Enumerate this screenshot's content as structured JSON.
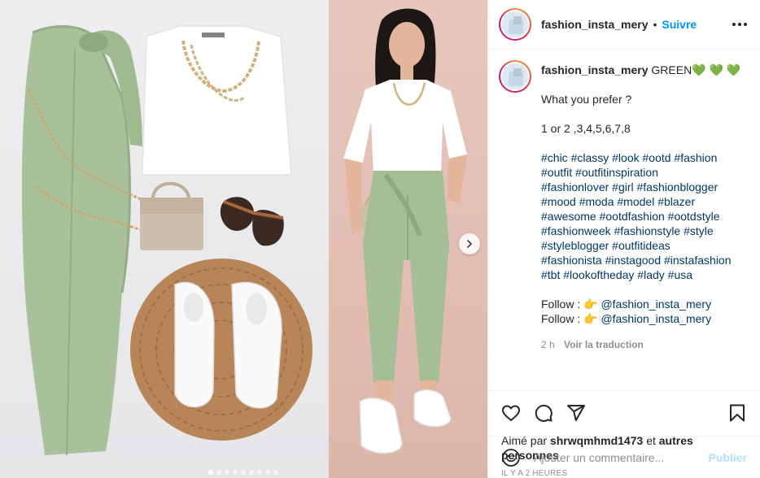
{
  "post": {
    "username": "fashion_insta_mery",
    "follow_label": "Suivre",
    "separator": "•"
  },
  "caption": {
    "username": "fashion_insta_mery",
    "title": "GREEN",
    "hearts": "💚 💚 💚",
    "line_question": "What you prefer ?",
    "line_options": "1 or 2 ,3,4,5,6,7,8",
    "hashtags": [
      "#chic #classy #look #ootd #fashion",
      "#outfit #outfitinspiration",
      "#fashionlover #girl #fashionblogger",
      "#mood #moda #model #blazer",
      "#awesome #ootdfashion #ootdstyle",
      "#fashionweek #fashionstyle #style",
      "#styleblogger #outfitideas",
      "#fashionista #instagood #instafashion",
      "#tbt #lookoftheday #lady #usa"
    ],
    "follow_lines": [
      {
        "prefix": "Follow : ",
        "emoji": "👉",
        "mention": "@fashion_insta_mery"
      },
      {
        "prefix": "Follow : ",
        "emoji": "👉",
        "mention": "@fashion_insta_mery"
      }
    ],
    "age": "2 h",
    "translate_label": "Voir la traduction"
  },
  "likes": {
    "prefix": "Aimé par",
    "user": "shrwqmhmd1473",
    "conj": "et",
    "others": "autres personnes"
  },
  "timestamp": "IL Y A 2 HEURES",
  "comment_box": {
    "placeholder": "Ajouter un commentaire...",
    "publish_label": "Publier"
  },
  "carousel": {
    "total_slides": 9,
    "active_index": 0
  },
  "icons": {
    "like": "heart-icon",
    "comment": "comment-icon",
    "share": "share-icon",
    "save": "bookmark-icon",
    "more": "more-icon",
    "next": "chevron-right-icon",
    "emoji": "emoji-icon"
  },
  "colors": {
    "accent_blue": "#0095f6",
    "link_blue": "#00376b",
    "muted": "#8e8e8e",
    "publish_disabled": "#b2dffc"
  }
}
